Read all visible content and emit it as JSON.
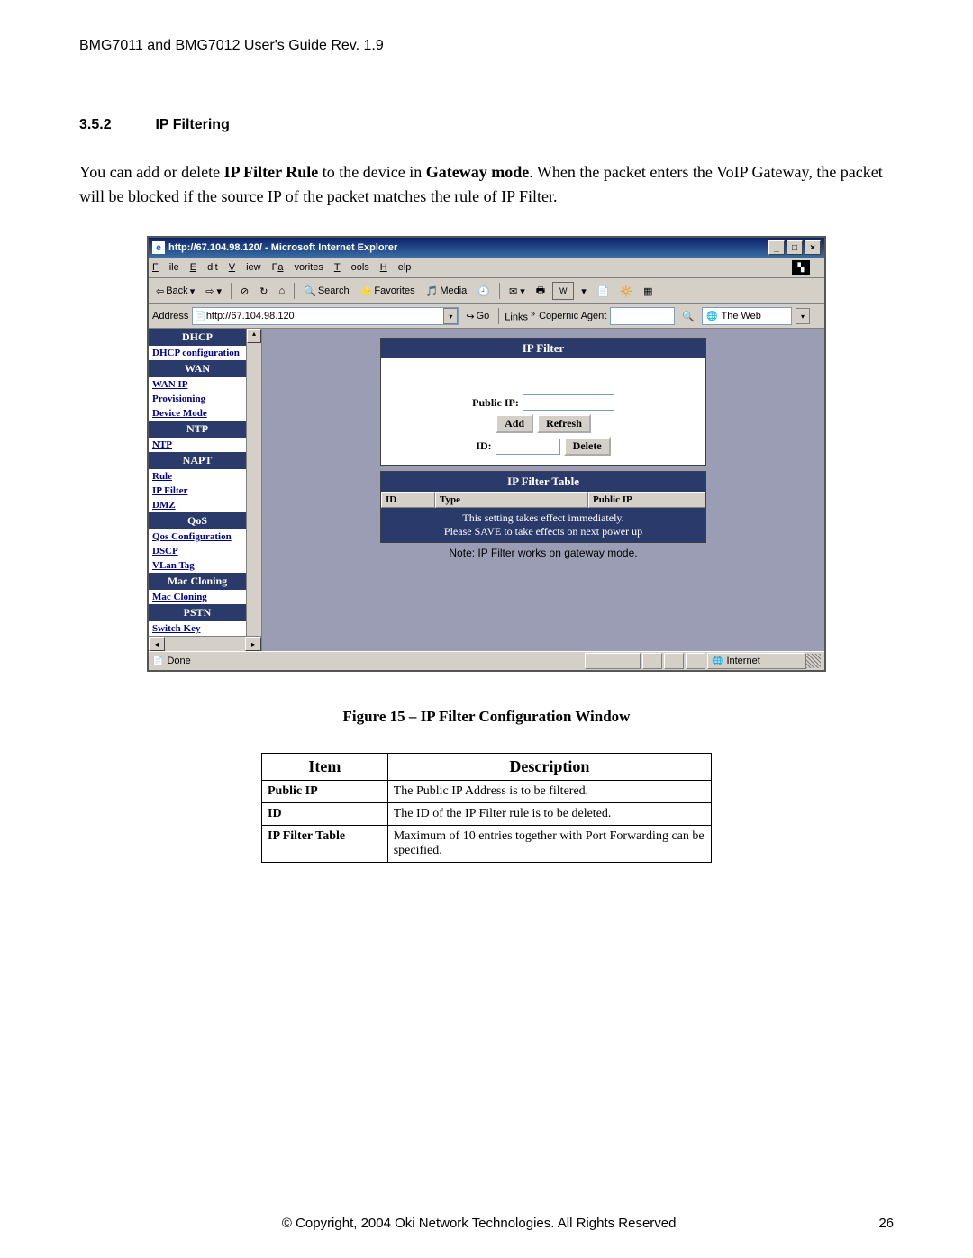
{
  "doc_header": "BMG7011 and BMG7012 User's Guide Rev. 1.9",
  "section": {
    "number": "3.5.2",
    "title": "IP Filtering"
  },
  "body_paragraph_parts": {
    "p1": "You can add or delete ",
    "b1": "IP Filter Rule",
    "p2": " to the device in ",
    "b2": "Gateway mode",
    "p3": ". When the packet enters the VoIP Gateway, the packet will be blocked if the source IP of the packet matches the rule of IP Filter."
  },
  "ie": {
    "title": "http://67.104.98.120/ - Microsoft Internet Explorer",
    "menus": [
      "File",
      "Edit",
      "View",
      "Favorites",
      "Tools",
      "Help"
    ],
    "toolbar": {
      "back": "Back",
      "search": "Search",
      "favorites": "Favorites",
      "media": "Media"
    },
    "address_label": "Address",
    "address_value": "http://67.104.98.120",
    "go_label": "Go",
    "links_label": "Links",
    "copernic_label": "Copernic Agent",
    "theweb_label": "The Web",
    "status_done": "Done",
    "status_zone": "Internet"
  },
  "sidebar": [
    {
      "type": "header",
      "label": "DHCP"
    },
    {
      "type": "link",
      "label": "DHCP configuration"
    },
    {
      "type": "header",
      "label": "WAN"
    },
    {
      "type": "link",
      "label": "WAN IP"
    },
    {
      "type": "link",
      "label": "Provisioning"
    },
    {
      "type": "link",
      "label": "Device Mode"
    },
    {
      "type": "header",
      "label": "NTP"
    },
    {
      "type": "link",
      "label": "NTP"
    },
    {
      "type": "header",
      "label": "NAPT"
    },
    {
      "type": "link",
      "label": "Rule"
    },
    {
      "type": "link",
      "label": "IP Filter"
    },
    {
      "type": "link",
      "label": "DMZ"
    },
    {
      "type": "header",
      "label": "QoS"
    },
    {
      "type": "link",
      "label": "Qos Configuration"
    },
    {
      "type": "link",
      "label": "DSCP"
    },
    {
      "type": "link",
      "label": "VLan Tag"
    },
    {
      "type": "header",
      "label": "Mac Cloning"
    },
    {
      "type": "link",
      "label": "Mac Cloning"
    },
    {
      "type": "header",
      "label": "PSTN"
    },
    {
      "type": "link",
      "label": "Switch Key"
    }
  ],
  "ipfilter": {
    "panel_title": "IP Filter",
    "public_ip_label": "Public IP:",
    "add_btn": "Add",
    "refresh_btn": "Refresh",
    "id_label": "ID:",
    "delete_btn": "Delete",
    "table_title": "IP Filter Table",
    "col_id": "ID",
    "col_type": "Type",
    "col_publicip": "Public IP",
    "note_line1": "This setting takes effect immediately.",
    "note_line2": "Please SAVE to take effects on next power up",
    "subnote": "Note: IP Filter works on gateway mode."
  },
  "figure_caption": "Figure 15 – IP Filter Configuration Window",
  "desc_table": {
    "h1": "Item",
    "h2": "Description",
    "rows": [
      {
        "item": "Public IP",
        "desc": "The Public IP Address is to be filtered."
      },
      {
        "item": "ID",
        "desc": "The ID of the IP Filter rule is to be deleted."
      },
      {
        "item": "IP Filter Table",
        "desc": "Maximum of 10 entries together with Port Forwarding can be specified."
      }
    ]
  },
  "footer": {
    "copyright": "© Copyright, 2004 Oki Network Technologies. All Rights Reserved",
    "page": "26"
  }
}
